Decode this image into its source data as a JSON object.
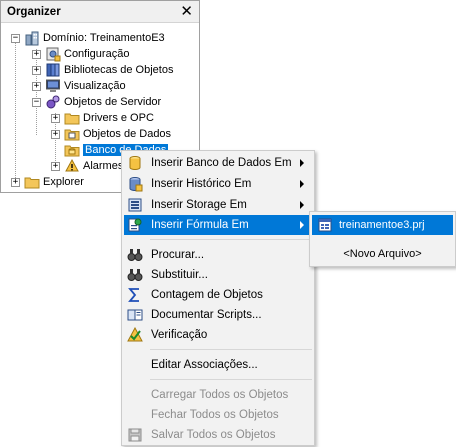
{
  "organizer": {
    "title": "Organizer",
    "close_glyph": "✕",
    "tree": {
      "root": "Domínio: TreinamentoE3",
      "items": [
        {
          "label": "Configuração",
          "icon": "config-icon"
        },
        {
          "label": "Bibliotecas de Objetos",
          "icon": "library-icon"
        },
        {
          "label": "Visualização",
          "icon": "monitor-icon"
        },
        {
          "label": "Objetos de Servidor",
          "icon": "server-objects-icon"
        },
        {
          "label": "Drivers e OPC",
          "icon": "folder-icon"
        },
        {
          "label": "Objetos de Dados",
          "icon": "folder-icon"
        },
        {
          "label": "Banco de Dados",
          "icon": "database-folder-icon"
        },
        {
          "label": "Alarmes",
          "icon": "alarm-icon"
        },
        {
          "label": "Explorer",
          "icon": "folder-icon"
        }
      ]
    }
  },
  "context_menu": {
    "items": [
      {
        "label": "Inserir Banco de Dados Em",
        "icon": "database-icon",
        "submenu": true
      },
      {
        "label": "Inserir Histórico Em",
        "icon": "history-icon",
        "submenu": true
      },
      {
        "label": "Inserir Storage Em",
        "icon": "storage-icon",
        "submenu": true
      },
      {
        "label": "Inserir Fórmula Em",
        "icon": "formula-icon",
        "submenu": true
      },
      {
        "label": "Procurar...",
        "icon": "binoculars-icon"
      },
      {
        "label": "Substituir...",
        "icon": "replace-icon"
      },
      {
        "label": "Contagem de Objetos",
        "icon": "sigma-icon"
      },
      {
        "label": "Documentar Scripts...",
        "icon": "document-icon"
      },
      {
        "label": "Verificação",
        "icon": "check-icon"
      },
      {
        "label": "Editar Associações..."
      },
      {
        "label": "Carregar Todos os Objetos"
      },
      {
        "label": "Fechar Todos os Objetos"
      },
      {
        "label": "Salvar Todos os Objetos",
        "icon": "save-icon"
      }
    ],
    "submenu_glyph": "▶"
  },
  "submenu": {
    "items": [
      {
        "label": "treinamentoe3.prj",
        "icon": "project-file-icon"
      },
      {
        "label": "<Novo Arquivo>"
      }
    ]
  },
  "colors": {
    "selection": "#0078d7",
    "menu_bg": "#f2f2f2",
    "disabled_text": "#8c8c8c"
  }
}
